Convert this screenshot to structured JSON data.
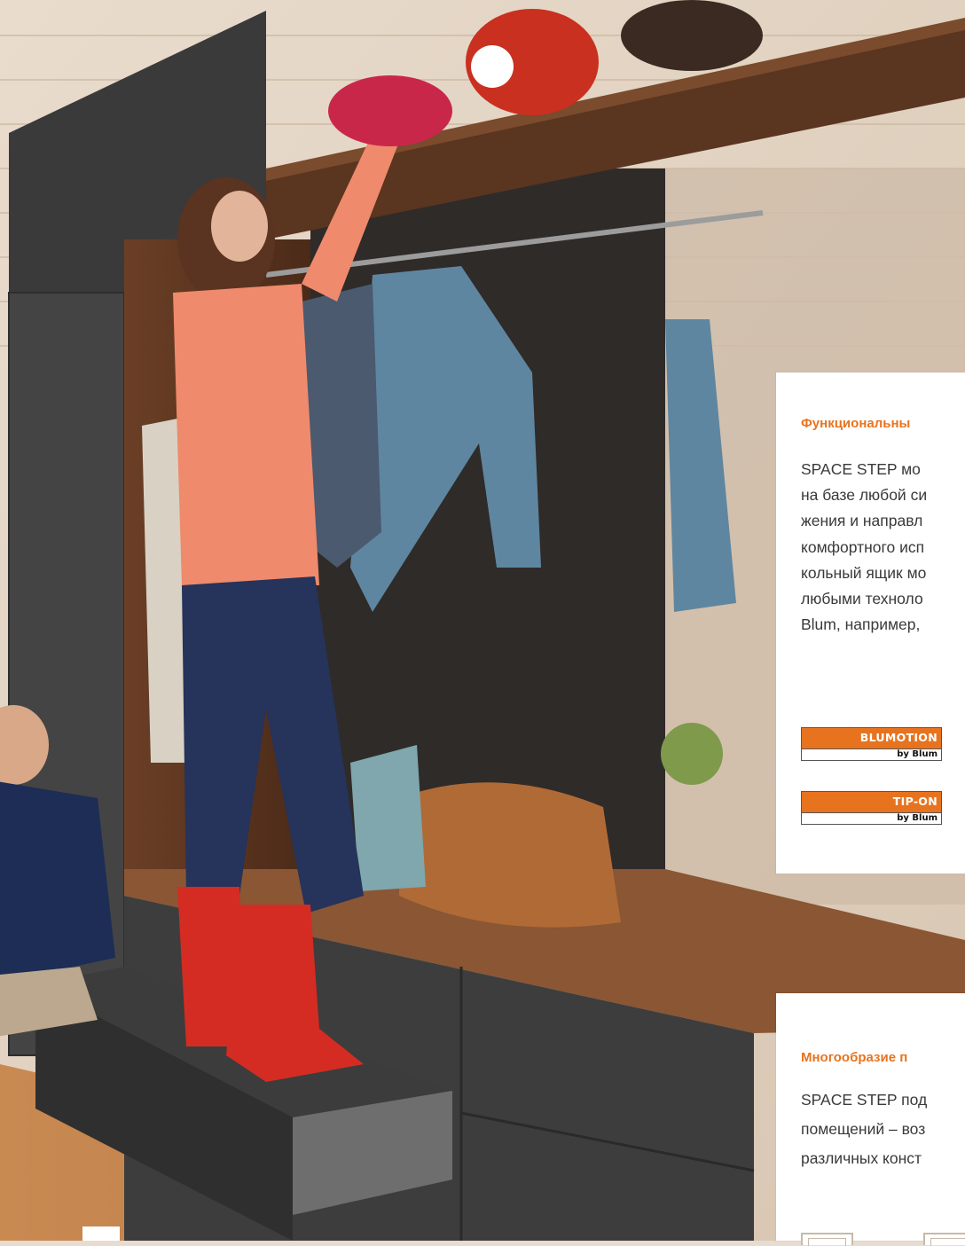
{
  "colors": {
    "accent": "#e8731e",
    "card_bg": "#ffffff",
    "text": "#3a3a3a"
  },
  "card_functional": {
    "heading": "Функциональны",
    "lines": [
      "SPACE STEP мо",
      "на базе любой си",
      "жения и направл",
      "комфортного исп",
      "кольный ящик мо",
      "любыми техноло",
      "Blum, например,"
    ]
  },
  "badges": {
    "blumotion": {
      "name": "BLUMOTION",
      "by": "by Blum"
    },
    "tipon": {
      "name": "TIP-ON",
      "by": "by Blum"
    }
  },
  "card_variety": {
    "heading": "Многообразие п",
    "lines": [
      "SPACE STEP под",
      "помещений – воз",
      "различных конст"
    ]
  }
}
